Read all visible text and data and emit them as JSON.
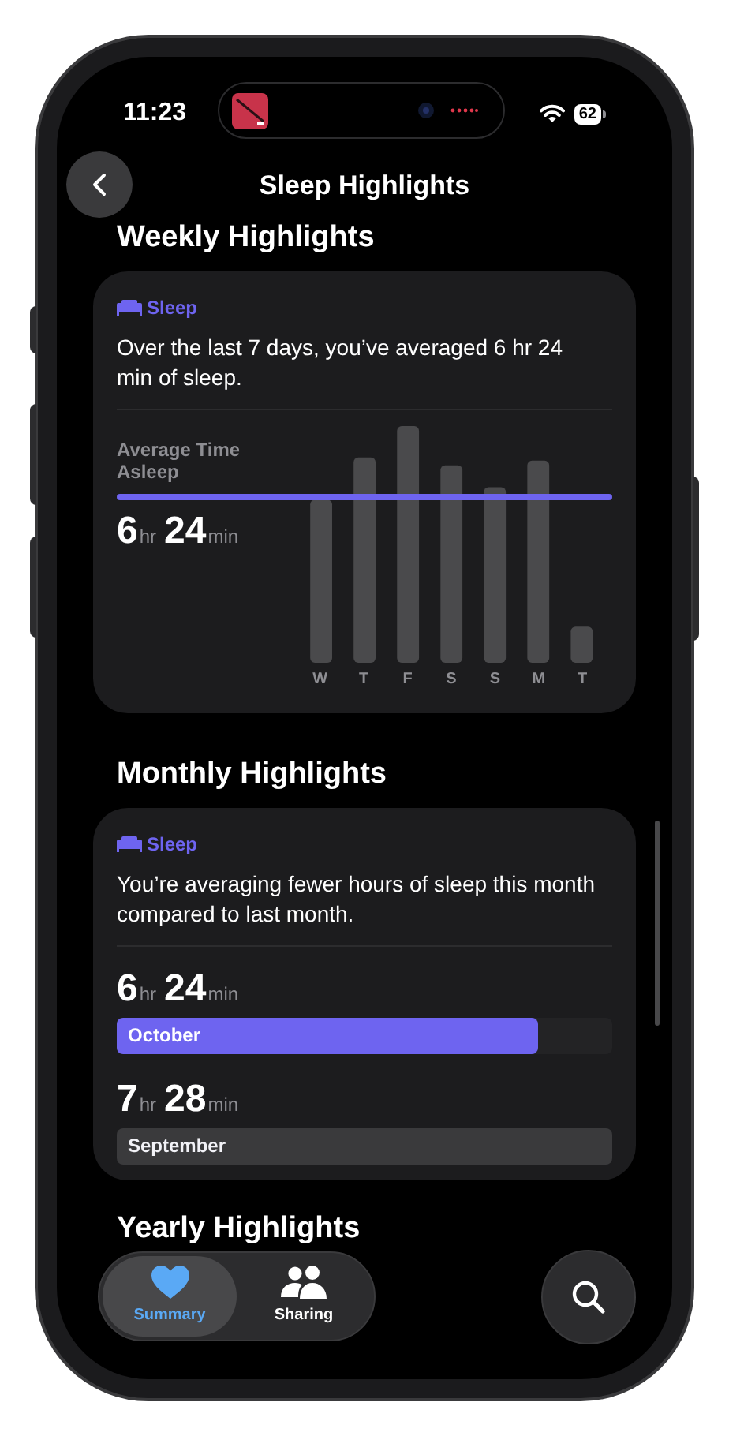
{
  "status_bar": {
    "time": "11:23",
    "battery": "62"
  },
  "nav": {
    "title": "Sleep Highlights"
  },
  "sections": [
    {
      "heading": "Weekly Highlights",
      "card": {
        "kind": "weekly",
        "category": "Sleep",
        "summary": "Over the last 7 days, you’ve averaged 6 hr 24 min of sleep.",
        "average_label": "Average Time Asleep",
        "average": {
          "hours": "6",
          "hr_unit": "hr",
          "minutes": "24",
          "min_unit": "min"
        },
        "days": [
          {
            "label": "W"
          },
          {
            "label": "T"
          },
          {
            "label": "F"
          },
          {
            "label": "S"
          },
          {
            "label": "S"
          },
          {
            "label": "M"
          },
          {
            "label": "T"
          }
        ]
      }
    },
    {
      "heading": "Monthly Highlights",
      "card": {
        "kind": "monthly",
        "category": "Sleep",
        "summary": "You’re averaging fewer hours of sleep this month compared to last month.",
        "months": [
          {
            "hours": "6",
            "hr_unit": "hr",
            "minutes": "24",
            "min_unit": "min",
            "name": "October",
            "current": true,
            "level": 0.85
          },
          {
            "hours": "7",
            "hr_unit": "hr",
            "minutes": "28",
            "min_unit": "min",
            "name": "September",
            "current": false
          }
        ]
      }
    },
    {
      "heading": "Yearly Highlights"
    }
  ],
  "tab_bar": {
    "tabs": [
      {
        "kind": "summary",
        "label": "Summary",
        "selected": true
      },
      {
        "kind": "sharing",
        "label": "Sharing",
        "selected": false
      }
    ]
  }
}
